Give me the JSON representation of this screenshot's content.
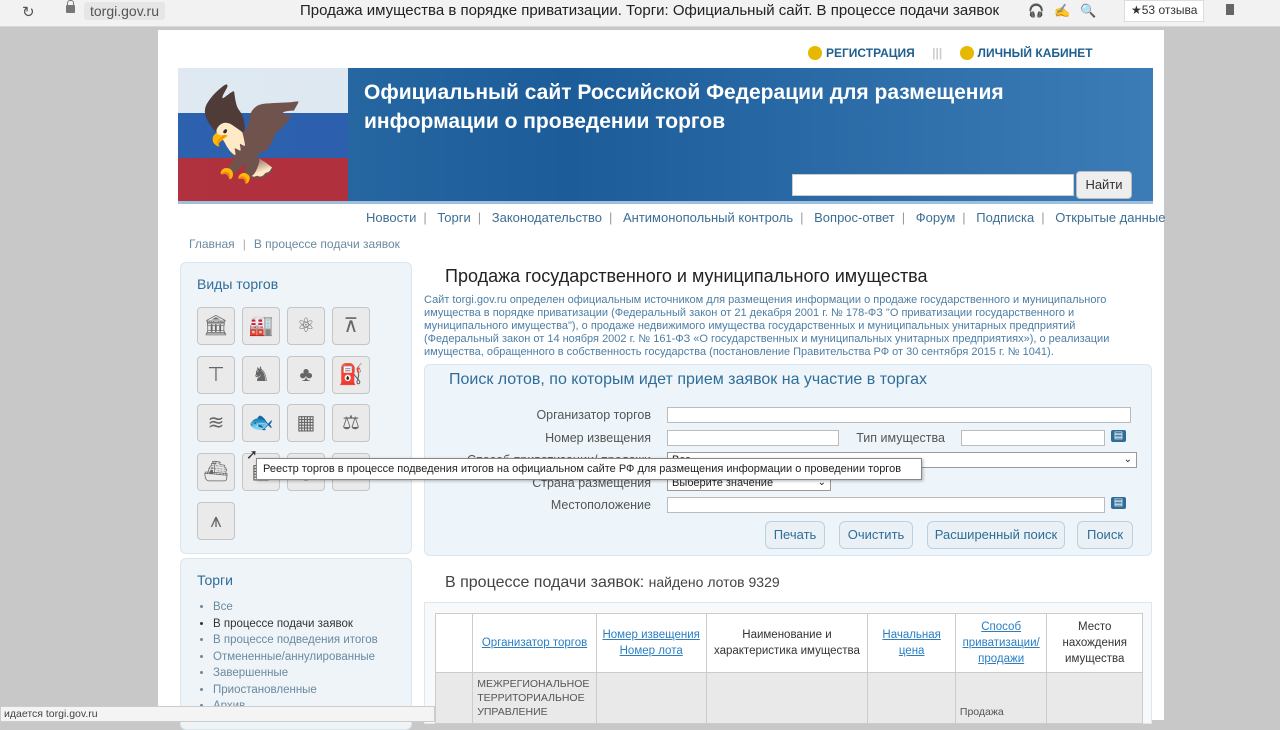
{
  "browser": {
    "url": "torgi.gov.ru",
    "page_title": "Продажа имущества в порядке приватизации. Торги: Официальный сайт. В процессе подачи заявок",
    "reviews": "★53 отзыва",
    "status_bar": "идается torgi.gov.ru"
  },
  "header": {
    "registration": "РЕГИСТРАЦИЯ",
    "cabinet": "ЛИЧНЫЙ КАБИНЕТ",
    "banner_title": "Официальный сайт Российской Федерации для размещения информации о проведении торгов",
    "search_button": "Найти"
  },
  "nav": [
    "Новости",
    "Торги",
    "Законодательство",
    "Антимонопольный контроль",
    "Вопрос-ответ",
    "Форум",
    "Подписка",
    "Открытые данные"
  ],
  "breadcrumb": [
    "Главная",
    "В процессе подачи заявок"
  ],
  "sidebar": {
    "types_title": "Виды торгов",
    "icons": [
      "bank-icon",
      "factory-icon",
      "atom-icon",
      "surveyor-icon",
      "crane-icon",
      "hunter-icon",
      "forest-icon",
      "oil-pump-icon",
      "water-icon",
      "fish-icon",
      "building-icon",
      "scales-icon",
      "jetski-icon",
      "field-icon",
      "tractor-icon",
      "star-icon",
      "tower-icon"
    ],
    "tooltip": "Реестр торгов в процессе подведения итогов на официальном сайте РФ для размещения информации о проведении торгов",
    "torgi_title": "Торги",
    "torgi_items": [
      "Все",
      "В процессе подачи заявок",
      "В процессе подведения итогов",
      "Отмененные/аннулированные",
      "Завершенные",
      "Приостановленные",
      "Архив"
    ]
  },
  "main": {
    "title": "Продажа государственного и муниципального имущества",
    "intro": "Сайт torgi.gov.ru определен официальным источником для размещения информации о продаже государственного и муниципального имущества в порядке приватизации (Федеральный закон от 21 декабря 2001 г. № 178-ФЗ \"О приватизации государственного и муниципального имущества\"), о продаже недвижимого имущества государственных и муниципальных унитарных предприятий (Федеральный закон от 14 ноября 2002 г. № 161-ФЗ «О государственных и муниципальных унитарных предприятиях»), о реализации имущества, обращенного в собственность государства (постановление Правительства РФ от 30 сентября 2015 г. № 1041).",
    "search": {
      "title": "Поиск лотов, по которым идет прием заявок на участие в торгах",
      "org_label": "Организатор торгов",
      "notice_label": "Номер извещения",
      "type_label": "Тип имущества",
      "method_label": "Способ приватизации/ продажи",
      "method_value": "Все",
      "country_label": "Страна размещения",
      "country_value": "Выберите значение",
      "location_label": "Местоположение",
      "buttons": {
        "print": "Печать",
        "clear": "Очистить",
        "advanced": "Расширенный поиск",
        "search": "Поиск"
      }
    },
    "results": {
      "title": "В процессе подачи заявок:",
      "count": "найдено лотов 9329",
      "headers": {
        "org": "Организатор торгов",
        "notice": "Номер извещения Номер лота",
        "name": "Наименование и характеристика имущества",
        "price": "Начальная цена",
        "method": "Способ приватизации/ продажи",
        "place": "Место нахождения имущества"
      },
      "row1": {
        "org": "МЕЖРЕГИОНАЛЬНОЕ ТЕРРИТОРИАЛЬНОЕ УПРАВЛЕНИЕ",
        "method": "Продажа"
      }
    }
  }
}
